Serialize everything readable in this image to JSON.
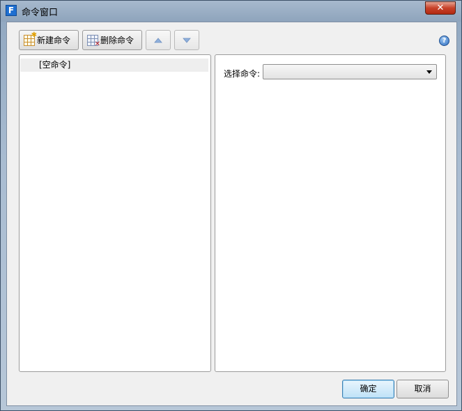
{
  "window": {
    "icon_letter": "F",
    "title": "命令窗口",
    "close_label": "✕"
  },
  "toolbar": {
    "new_label": "新建命令",
    "delete_label": "删除命令",
    "move_up_icon": "triangle-up-icon",
    "move_down_icon": "triangle-down-icon",
    "help_glyph": "?"
  },
  "command_list": {
    "items": [
      {
        "label": "[空命令]"
      }
    ]
  },
  "command_detail": {
    "select_label": "选择命令:",
    "select_value": ""
  },
  "footer": {
    "ok_label": "确定",
    "cancel_label": "取消"
  },
  "colors": {
    "title_bar": "#8ea4bc",
    "client_bg": "#f0f0f0",
    "close_button": "#c7422a",
    "ok_button_border": "#3c7fb1",
    "arrow_fill": "#8fb0dc"
  }
}
